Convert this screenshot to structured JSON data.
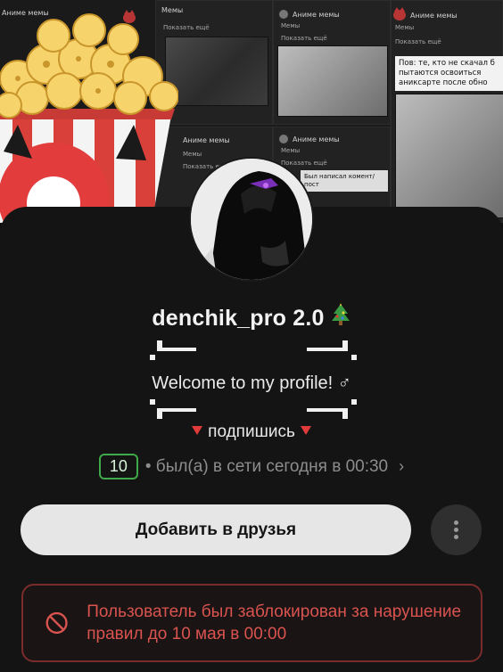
{
  "cover": {
    "cards": [
      {
        "group": "Аниме мемы",
        "subtitle": "Мемы",
        "show_more": "Показать ещё"
      },
      {
        "group": "Мемы",
        "subtitle": "",
        "show_more": "Показать ещё"
      },
      {
        "group": "Аниме мемы",
        "subtitle": "Мемы",
        "show_more": "Показать ещё"
      },
      {
        "group": "Аниме мемы",
        "subtitle": "Мемы",
        "show_more": "Показать ещё"
      },
      {
        "group": "Аниме мемы",
        "subtitle": "Мемы",
        "show_more": "Показать ещё"
      }
    ],
    "meme_caption_right": "Пов: те, кто не скачал б пытаются освоиться аниксарте после обно",
    "meme_caption_mid": "Был напиcал комент/пост"
  },
  "profile": {
    "username": "denchik_pro 2.0",
    "username_emoji": "🎄",
    "bio": "Welcome to my profile! ♂",
    "subscribe_text": "подпишись",
    "level": "10",
    "last_seen": "• был(а) в сети сегодня в 00:30",
    "chevron": "›"
  },
  "actions": {
    "add_friend_label": "Добавить в друзья",
    "more_icon": "vertical-dots-icon"
  },
  "ban_notice": {
    "text": "Пользователь был заблокирован за нарушение правил до 10 мая в 00:00",
    "icon": "prohibited-icon",
    "color": "#d9534f"
  },
  "colors": {
    "background": "#141414",
    "accent_green": "#3ea84a",
    "accent_red": "#e03a3a"
  }
}
